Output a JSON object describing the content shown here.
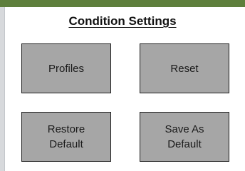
{
  "colors": {
    "header_bar": "#5e7f3c",
    "button_fill": "#a6a6a6",
    "button_border": "#1f1f1f"
  },
  "panel": {
    "title": "Condition Settings"
  },
  "buttons": {
    "profiles": "Profiles",
    "reset": "Reset",
    "restore_default": "Restore\nDefault",
    "save_as_default": "Save As\nDefault"
  }
}
